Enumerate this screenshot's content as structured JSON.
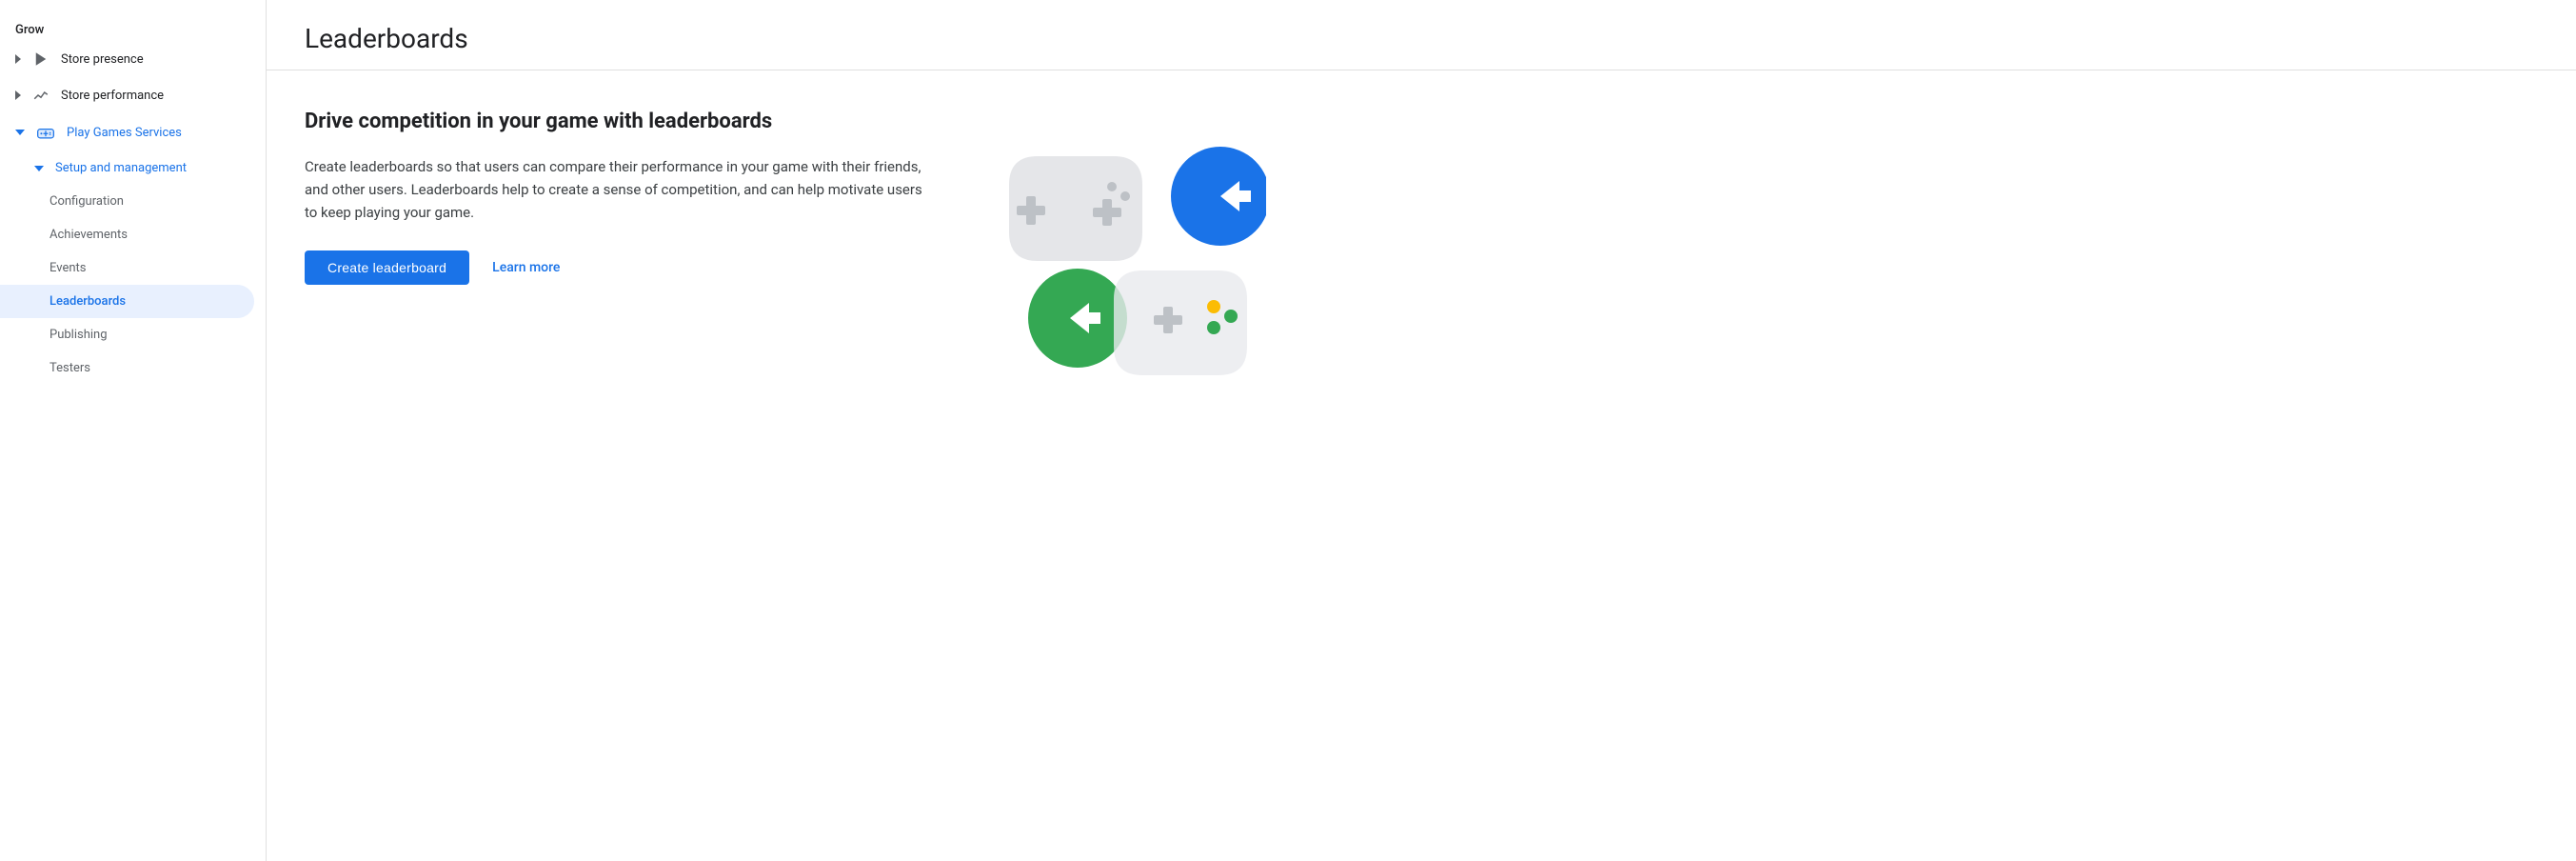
{
  "sidebar": {
    "grow_label": "Grow",
    "items": [
      {
        "id": "store-presence",
        "label": "Store presence",
        "icon": "play-icon",
        "expanded": false,
        "active": false,
        "level": 0
      },
      {
        "id": "store-performance",
        "label": "Store performance",
        "icon": "trending-icon",
        "expanded": false,
        "active": false,
        "level": 0
      },
      {
        "id": "play-games-services",
        "label": "Play Games Services",
        "icon": "gamepad-icon",
        "expanded": true,
        "active": false,
        "level": 0
      }
    ],
    "nested_items": [
      {
        "id": "setup-management",
        "label": "Setup and management",
        "expanded": true,
        "active": false,
        "level": 1
      }
    ],
    "sub_items": [
      {
        "id": "configuration",
        "label": "Configuration",
        "active": false,
        "level": 2
      },
      {
        "id": "achievements",
        "label": "Achievements",
        "active": false,
        "level": 2
      },
      {
        "id": "events",
        "label": "Events",
        "active": false,
        "level": 2
      },
      {
        "id": "leaderboards",
        "label": "Leaderboards",
        "active": true,
        "level": 2
      },
      {
        "id": "publishing",
        "label": "Publishing",
        "active": false,
        "level": 2
      },
      {
        "id": "testers",
        "label": "Testers",
        "active": false,
        "level": 2
      }
    ]
  },
  "page": {
    "title": "Leaderboards",
    "heading": "Drive competition in your game with leaderboards",
    "description": "Create leaderboards so that users can compare their performance in your game with their friends, and other users. Leaderboards help to create a sense of competition, and can help motivate users to keep playing your game.",
    "create_button": "Create leaderboard",
    "learn_more": "Learn more"
  },
  "colors": {
    "blue": "#1a73e8",
    "green": "#34a853",
    "yellow": "#fbbc04",
    "gray_light": "#dadce0",
    "gray_controller": "#bdc1c6"
  }
}
